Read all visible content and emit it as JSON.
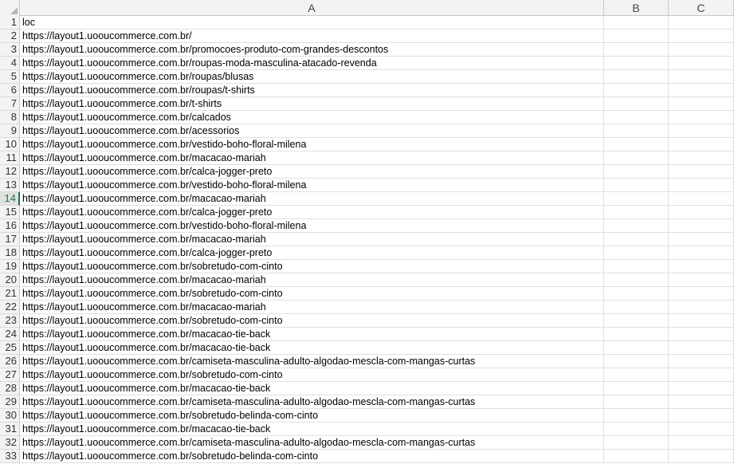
{
  "columns": [
    "A",
    "B",
    "C"
  ],
  "active_row": 14,
  "rows": [
    {
      "n": "1",
      "a": "loc"
    },
    {
      "n": "2",
      "a": "https://layout1.uooucommerce.com.br/"
    },
    {
      "n": "3",
      "a": "https://layout1.uooucommerce.com.br/promocoes-produto-com-grandes-descontos"
    },
    {
      "n": "4",
      "a": "https://layout1.uooucommerce.com.br/roupas-moda-masculina-atacado-revenda"
    },
    {
      "n": "5",
      "a": "https://layout1.uooucommerce.com.br/roupas/blusas"
    },
    {
      "n": "6",
      "a": "https://layout1.uooucommerce.com.br/roupas/t-shirts"
    },
    {
      "n": "7",
      "a": "https://layout1.uooucommerce.com.br/t-shirts"
    },
    {
      "n": "8",
      "a": "https://layout1.uooucommerce.com.br/calcados"
    },
    {
      "n": "9",
      "a": "https://layout1.uooucommerce.com.br/acessorios"
    },
    {
      "n": "10",
      "a": "https://layout1.uooucommerce.com.br/vestido-boho-floral-milena"
    },
    {
      "n": "11",
      "a": "https://layout1.uooucommerce.com.br/macacao-mariah"
    },
    {
      "n": "12",
      "a": "https://layout1.uooucommerce.com.br/calca-jogger-preto"
    },
    {
      "n": "13",
      "a": "https://layout1.uooucommerce.com.br/vestido-boho-floral-milena"
    },
    {
      "n": "14",
      "a": "https://layout1.uooucommerce.com.br/macacao-mariah"
    },
    {
      "n": "15",
      "a": "https://layout1.uooucommerce.com.br/calca-jogger-preto"
    },
    {
      "n": "16",
      "a": "https://layout1.uooucommerce.com.br/vestido-boho-floral-milena"
    },
    {
      "n": "17",
      "a": "https://layout1.uooucommerce.com.br/macacao-mariah"
    },
    {
      "n": "18",
      "a": "https://layout1.uooucommerce.com.br/calca-jogger-preto"
    },
    {
      "n": "19",
      "a": "https://layout1.uooucommerce.com.br/sobretudo-com-cinto"
    },
    {
      "n": "20",
      "a": "https://layout1.uooucommerce.com.br/macacao-mariah"
    },
    {
      "n": "21",
      "a": "https://layout1.uooucommerce.com.br/sobretudo-com-cinto"
    },
    {
      "n": "22",
      "a": "https://layout1.uooucommerce.com.br/macacao-mariah"
    },
    {
      "n": "23",
      "a": "https://layout1.uooucommerce.com.br/sobretudo-com-cinto"
    },
    {
      "n": "24",
      "a": "https://layout1.uooucommerce.com.br/macacao-tie-back"
    },
    {
      "n": "25",
      "a": "https://layout1.uooucommerce.com.br/macacao-tie-back"
    },
    {
      "n": "26",
      "a": "https://layout1.uooucommerce.com.br/camiseta-masculina-adulto-algodao-mescla-com-mangas-curtas"
    },
    {
      "n": "27",
      "a": "https://layout1.uooucommerce.com.br/sobretudo-com-cinto"
    },
    {
      "n": "28",
      "a": "https://layout1.uooucommerce.com.br/macacao-tie-back"
    },
    {
      "n": "29",
      "a": "https://layout1.uooucommerce.com.br/camiseta-masculina-adulto-algodao-mescla-com-mangas-curtas"
    },
    {
      "n": "30",
      "a": "https://layout1.uooucommerce.com.br/sobretudo-belinda-com-cinto"
    },
    {
      "n": "31",
      "a": "https://layout1.uooucommerce.com.br/macacao-tie-back"
    },
    {
      "n": "32",
      "a": "https://layout1.uooucommerce.com.br/camiseta-masculina-adulto-algodao-mescla-com-mangas-curtas"
    },
    {
      "n": "33",
      "a": "https://layout1.uooucommerce.com.br/sobretudo-belinda-com-cinto"
    }
  ]
}
